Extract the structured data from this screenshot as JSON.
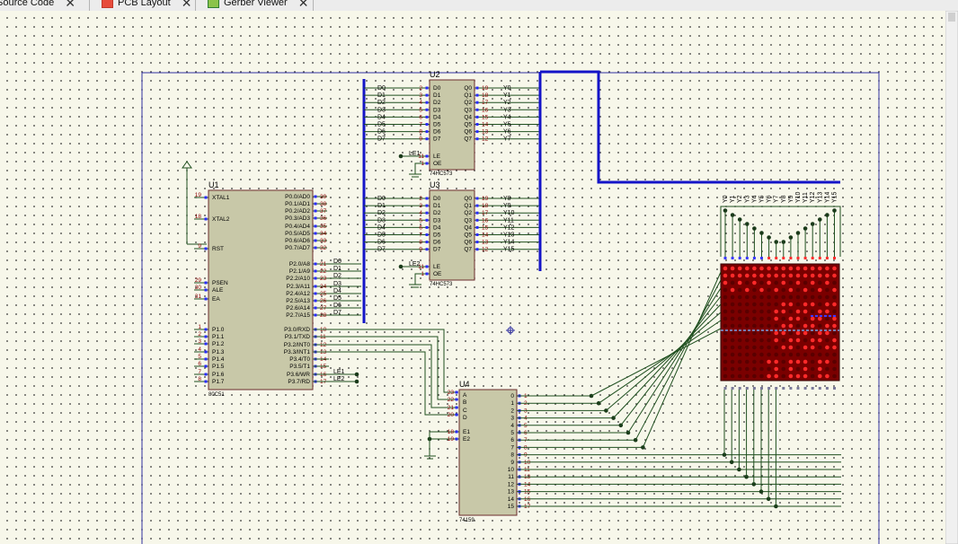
{
  "tabs": [
    {
      "label": "Source Code"
    },
    {
      "label": "PCB Layout"
    },
    {
      "label": "Gerber Viewer"
    }
  ],
  "colors": {
    "wire": "#1f4f1f",
    "bus": "#1414c8",
    "chip": "#c8c8a8",
    "chip_border": "#6b2d2d",
    "pin": "#8b0000",
    "led_red": "#ff2a2a",
    "led_dark": "#5a0000",
    "matrix_bg": "#7a0000",
    "frame": "#3030a0"
  },
  "u1": {
    "ref": "U1",
    "type": "80C51",
    "left_pins": [
      {
        "num": "19",
        "label": "XTAL1"
      },
      {
        "num": "18",
        "label": "XTAL2"
      },
      {
        "num": "9",
        "label": "RST"
      },
      {
        "num": "29",
        "label": "PSEN"
      },
      {
        "num": "30",
        "label": "ALE"
      },
      {
        "num": "31",
        "label": "EA"
      },
      {
        "num": "1",
        "label": "P1.0"
      },
      {
        "num": "2",
        "label": "P1.1"
      },
      {
        "num": "3",
        "label": "P1.2"
      },
      {
        "num": "4",
        "label": "P1.3"
      },
      {
        "num": "5",
        "label": "P1.4"
      },
      {
        "num": "6",
        "label": "P1.5"
      },
      {
        "num": "7",
        "label": "P1.6"
      },
      {
        "num": "8",
        "label": "P1.7"
      }
    ],
    "right_p0": [
      {
        "num": "39",
        "label": "P0.0/AD0"
      },
      {
        "num": "38",
        "label": "P0.1/AD1"
      },
      {
        "num": "37",
        "label": "P0.2/AD2"
      },
      {
        "num": "36",
        "label": "P0.3/AD3"
      },
      {
        "num": "35",
        "label": "P0.4/AD4"
      },
      {
        "num": "34",
        "label": "P0.5/AD5"
      },
      {
        "num": "33",
        "label": "P0.6/AD6"
      },
      {
        "num": "32",
        "label": "P0.7/AD7"
      }
    ],
    "right_p2": [
      {
        "num": "21",
        "label": "P2.0/A8",
        "net": "D0"
      },
      {
        "num": "22",
        "label": "P2.1/A9",
        "net": "D1"
      },
      {
        "num": "23",
        "label": "P2.2/A10",
        "net": "D2"
      },
      {
        "num": "24",
        "label": "P2.3/A11",
        "net": "D3"
      },
      {
        "num": "25",
        "label": "P2.4/A12",
        "net": "D4"
      },
      {
        "num": "26",
        "label": "P2.5/A13",
        "net": "D5"
      },
      {
        "num": "27",
        "label": "P2.6/A14",
        "net": "D6"
      },
      {
        "num": "28",
        "label": "P2.7/A15",
        "net": "D7"
      }
    ],
    "right_p3": [
      {
        "num": "10",
        "label": "P3.0/RXD",
        "net": ""
      },
      {
        "num": "11",
        "label": "P3.1/TXD",
        "net": ""
      },
      {
        "num": "12",
        "label": "P3.2/INT0",
        "net": ""
      },
      {
        "num": "13",
        "label": "P3.3/INT1",
        "net": ""
      },
      {
        "num": "14",
        "label": "P3.4/T0",
        "net": ""
      },
      {
        "num": "15",
        "label": "P3.5/T1",
        "net": ""
      },
      {
        "num": "16",
        "label": "P3.6/WR",
        "net": "LE1"
      },
      {
        "num": "17",
        "label": "P3.7/RD",
        "net": "LE2"
      }
    ]
  },
  "u2": {
    "ref": "U2",
    "type": "74HC573",
    "le_net": "LE1",
    "inputs": [
      {
        "net": "D0",
        "num": "2",
        "label": "D0"
      },
      {
        "net": "D1",
        "num": "3",
        "label": "D1"
      },
      {
        "net": "D2",
        "num": "4",
        "label": "D2"
      },
      {
        "net": "D3",
        "num": "5",
        "label": "D3"
      },
      {
        "net": "D4",
        "num": "6",
        "label": "D4"
      },
      {
        "net": "D5",
        "num": "7",
        "label": "D5"
      },
      {
        "net": "D6",
        "num": "8",
        "label": "D6"
      },
      {
        "net": "D7",
        "num": "9",
        "label": "D7"
      }
    ],
    "outputs": [
      {
        "label": "Q0",
        "num": "19",
        "net": "Y0"
      },
      {
        "label": "Q1",
        "num": "18",
        "net": "Y1"
      },
      {
        "label": "Q2",
        "num": "17",
        "net": "Y2"
      },
      {
        "label": "Q3",
        "num": "16",
        "net": "Y3"
      },
      {
        "label": "Q4",
        "num": "15",
        "net": "Y4"
      },
      {
        "label": "Q5",
        "num": "14",
        "net": "Y5"
      },
      {
        "label": "Q6",
        "num": "13",
        "net": "Y6"
      },
      {
        "label": "Q7",
        "num": "12",
        "net": "Y7"
      }
    ],
    "ctrl": [
      {
        "num": "11",
        "label": "LE"
      },
      {
        "num": "1",
        "label": "OE"
      }
    ]
  },
  "u3": {
    "ref": "U3",
    "type": "74HC573",
    "le_net": "LE2",
    "inputs": [
      {
        "net": "D0",
        "num": "2",
        "label": "D0"
      },
      {
        "net": "D1",
        "num": "3",
        "label": "D1"
      },
      {
        "net": "D2",
        "num": "4",
        "label": "D2"
      },
      {
        "net": "D3",
        "num": "5",
        "label": "D3"
      },
      {
        "net": "D4",
        "num": "6",
        "label": "D4"
      },
      {
        "net": "D5",
        "num": "7",
        "label": "D5"
      },
      {
        "net": "D6",
        "num": "8",
        "label": "D6"
      },
      {
        "net": "D7",
        "num": "9",
        "label": "D7"
      }
    ],
    "outputs": [
      {
        "label": "Q0",
        "num": "19",
        "net": "Y8"
      },
      {
        "label": "Q1",
        "num": "18",
        "net": "Y9"
      },
      {
        "label": "Q2",
        "num": "17",
        "net": "Y10"
      },
      {
        "label": "Q3",
        "num": "16",
        "net": "Y11"
      },
      {
        "label": "Q4",
        "num": "15",
        "net": "Y12"
      },
      {
        "label": "Q5",
        "num": "14",
        "net": "Y13"
      },
      {
        "label": "Q6",
        "num": "13",
        "net": "Y14"
      },
      {
        "label": "Q7",
        "num": "12",
        "net": "Y15"
      }
    ],
    "ctrl": [
      {
        "num": "11",
        "label": "LE"
      },
      {
        "num": "1",
        "label": "OE"
      }
    ]
  },
  "u4": {
    "ref": "U4",
    "type": "74159",
    "addr": [
      {
        "num": "23",
        "label": "A"
      },
      {
        "num": "22",
        "label": "B"
      },
      {
        "num": "21",
        "label": "C"
      },
      {
        "num": "20",
        "label": "D"
      }
    ],
    "enable": [
      {
        "num": "18",
        "label": "E1"
      },
      {
        "num": "19",
        "label": "E2"
      }
    ],
    "outputs": [
      {
        "label": "0",
        "num": "1"
      },
      {
        "label": "1",
        "num": "2"
      },
      {
        "label": "2",
        "num": "3"
      },
      {
        "label": "3",
        "num": "4"
      },
      {
        "label": "4",
        "num": "5"
      },
      {
        "label": "5",
        "num": "6"
      },
      {
        "label": "6",
        "num": "7"
      },
      {
        "label": "7",
        "num": "8"
      },
      {
        "label": "8",
        "num": "9"
      },
      {
        "label": "9",
        "num": "10"
      },
      {
        "label": "10",
        "num": "11"
      },
      {
        "label": "11",
        "num": "13"
      },
      {
        "label": "12",
        "num": "14"
      },
      {
        "label": "13",
        "num": "15"
      },
      {
        "label": "14",
        "num": "16"
      },
      {
        "label": "15",
        "num": "17"
      }
    ]
  },
  "matrix": {
    "col_labels": [
      "Y0",
      "Y1",
      "Y2",
      "Y3",
      "Y4",
      "Y5",
      "Y6",
      "Y7",
      "Y8",
      "Y9",
      "Y10",
      "Y11",
      "Y12",
      "Y13",
      "Y14",
      "Y15"
    ]
  }
}
